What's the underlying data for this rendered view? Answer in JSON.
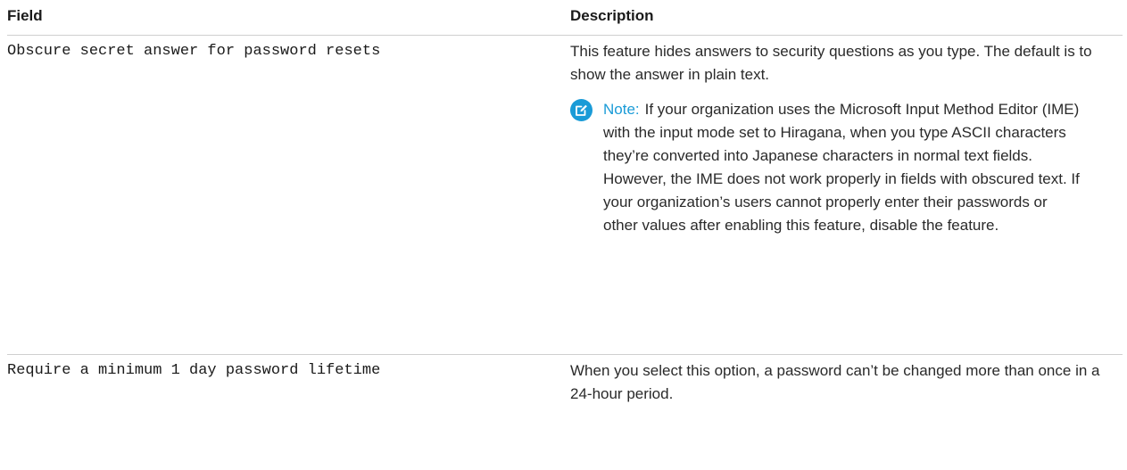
{
  "table": {
    "headers": {
      "field": "Field",
      "description": "Description"
    },
    "rows": [
      {
        "field": "Obscure secret answer for password resets",
        "description": "This feature hides answers to security questions as you type. The default is to show the answer in plain text.",
        "note": {
          "label": "Note:",
          "text": "If your organization uses the Microsoft Input Method Editor (IME) with the input mode set to Hiragana, when you type ASCII characters they’re converted into Japanese characters in normal text fields. However, the IME does not work properly in fields with obscured text. If your organization’s users cannot properly enter their passwords or other values after enabling this feature, disable the feature."
        }
      },
      {
        "field": "Require a minimum 1 day password lifetime",
        "description": "When you select this option, a password can’t be changed more than once in a 24-hour period."
      }
    ]
  },
  "icons": {
    "note_icon": "edit-note-icon"
  },
  "colors": {
    "note_accent": "#1a9bd7",
    "rule": "#cfcfcf"
  }
}
